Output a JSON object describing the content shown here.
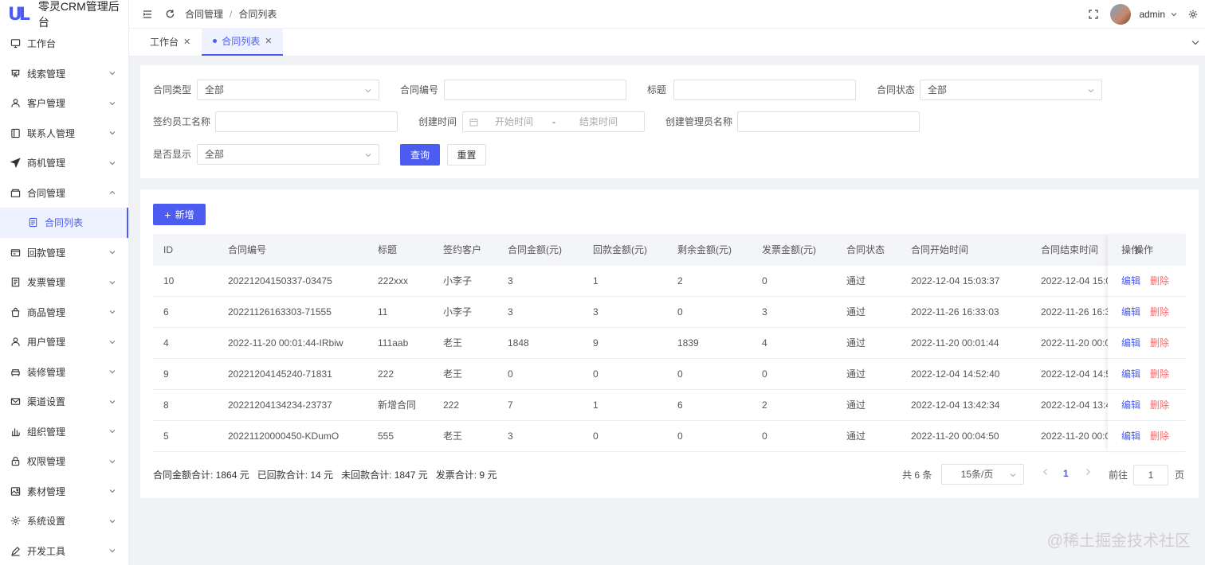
{
  "app": {
    "logo_mark": "UL",
    "title": "零灵CRM管理后台",
    "brand_color": "#4c5cf0"
  },
  "sidebar": {
    "items": [
      {
        "label": "工作台",
        "icon": "monitor-icon",
        "has_arrow": false
      },
      {
        "label": "线索管理",
        "icon": "clue-icon",
        "has_arrow": true
      },
      {
        "label": "客户管理",
        "icon": "user-icon",
        "has_arrow": true
      },
      {
        "label": "联系人管理",
        "icon": "contact-book-icon",
        "has_arrow": true
      },
      {
        "label": "商机管理",
        "icon": "send-icon",
        "has_arrow": true
      },
      {
        "label": "合同管理",
        "icon": "folder-icon",
        "has_arrow": true,
        "expanded": true
      },
      {
        "label": "合同列表",
        "icon": "document-icon",
        "sub": true,
        "active": true
      },
      {
        "label": "回款管理",
        "icon": "wallet-icon",
        "has_arrow": true
      },
      {
        "label": "发票管理",
        "icon": "invoice-icon",
        "has_arrow": true
      },
      {
        "label": "商品管理",
        "icon": "bag-icon",
        "has_arrow": true
      },
      {
        "label": "用户管理",
        "icon": "user-icon",
        "has_arrow": true
      },
      {
        "label": "装修管理",
        "icon": "sofa-icon",
        "has_arrow": true
      },
      {
        "label": "渠道设置",
        "icon": "mail-icon",
        "has_arrow": true
      },
      {
        "label": "组织管理",
        "icon": "org-icon",
        "has_arrow": true
      },
      {
        "label": "权限管理",
        "icon": "lock-icon",
        "has_arrow": true
      },
      {
        "label": "素材管理",
        "icon": "image-icon",
        "has_arrow": true
      },
      {
        "label": "系统设置",
        "icon": "gear-icon",
        "has_arrow": true
      },
      {
        "label": "开发工具",
        "icon": "pen-icon",
        "has_arrow": true
      }
    ]
  },
  "header": {
    "breadcrumb": [
      "合同管理",
      "合同列表"
    ],
    "user": "admin"
  },
  "tabs": [
    {
      "label": "工作台",
      "active": false
    },
    {
      "label": "合同列表",
      "active": true
    }
  ],
  "search": {
    "contract_type_label": "合同类型",
    "contract_type_value": "全部",
    "contract_no_label": "合同编号",
    "contract_no_value": "",
    "title_label": "标题",
    "title_value": "",
    "status_label": "合同状态",
    "status_value": "全部",
    "signer_label": "签约员工名称",
    "signer_value": "",
    "created_label": "创建时间",
    "start_placeholder": "开始时间",
    "range_sep": "-",
    "end_placeholder": "结束时间",
    "creator_label": "创建管理员名称",
    "creator_value": "",
    "visible_label": "是否显示",
    "visible_value": "全部",
    "query_btn": "查询",
    "reset_btn": "重置"
  },
  "toolbar": {
    "add_btn": "新增"
  },
  "table": {
    "columns": [
      "ID",
      "合同编号",
      "标题",
      "签约客户",
      "合同金额(元)",
      "回款金额(元)",
      "剩余金额(元)",
      "发票金额(元)",
      "合同状态",
      "合同开始时间",
      "合同结束时间",
      "操作"
    ],
    "rows": [
      {
        "id": "10",
        "no": "20221204150337-03475",
        "title": "222xxx",
        "customer": "小李子",
        "amount": "3",
        "paid": "1",
        "remain": "2",
        "invoice": "0",
        "status": "通过",
        "start": "2022-12-04 15:03:37",
        "end": "2022-12-04 15:0",
        "edit": "编辑",
        "del": "删除"
      },
      {
        "id": "6",
        "no": "20221126163303-71555",
        "title": "11",
        "customer": "小李子",
        "amount": "3",
        "paid": "3",
        "remain": "0",
        "invoice": "3",
        "status": "通过",
        "start": "2022-11-26 16:33:03",
        "end": "2022-11-26 16:3",
        "edit": "编辑",
        "del": "删除"
      },
      {
        "id": "4",
        "no": "2022-11-20 00:01:44-IRbiw",
        "title": "111aab",
        "customer": "老王",
        "amount": "1848",
        "paid": "9",
        "remain": "1839",
        "invoice": "4",
        "status": "通过",
        "start": "2022-11-20 00:01:44",
        "end": "2022-11-20 00:0",
        "edit": "编辑",
        "del": "删除"
      },
      {
        "id": "9",
        "no": "20221204145240-71831",
        "title": "222",
        "customer": "老王",
        "amount": "0",
        "paid": "0",
        "remain": "0",
        "invoice": "0",
        "status": "通过",
        "start": "2022-12-04 14:52:40",
        "end": "2022-12-04 14:5",
        "edit": "编辑",
        "del": "删除"
      },
      {
        "id": "8",
        "no": "20221204134234-23737",
        "title": "新增合同",
        "customer": "222",
        "amount": "7",
        "paid": "1",
        "remain": "6",
        "invoice": "2",
        "status": "通过",
        "start": "2022-12-04 13:42:34",
        "end": "2022-12-04 13:4",
        "edit": "编辑",
        "del": "删除"
      },
      {
        "id": "5",
        "no": "20221120000450-KDumO",
        "title": "555",
        "customer": "老王",
        "amount": "3",
        "paid": "0",
        "remain": "0",
        "invoice": "0",
        "status": "通过",
        "start": "2022-11-20 00:04:50",
        "end": "2022-11-20 00:0",
        "edit": "编辑",
        "del": "删除"
      }
    ]
  },
  "summary": {
    "total_amount": "合同金额合计: 1864 元",
    "paid_total": "已回款合计: 14 元",
    "unpaid_total": "未回款合计: 1847 元",
    "invoice_total": "发票合计: 9 元"
  },
  "pagination": {
    "total": "共 6 条",
    "page_size": "15条/页",
    "current": "1",
    "goto_label": "前往",
    "goto_value": "1",
    "page_unit": "页"
  },
  "watermark": "@稀土掘金技术社区"
}
